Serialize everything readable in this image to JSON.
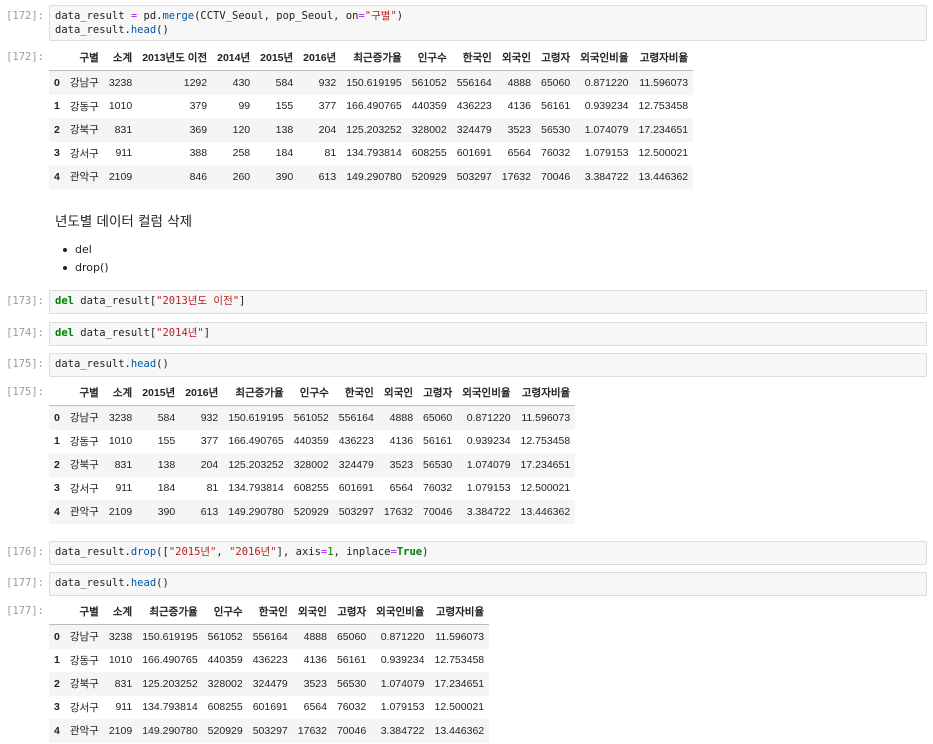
{
  "cells": [
    {
      "id": "c172in",
      "prompt": "[172]:",
      "code": [
        [
          [
            "plain",
            "data_result "
          ],
          [
            "op",
            "="
          ],
          [
            "plain",
            " pd."
          ],
          [
            "fn",
            "merge"
          ],
          [
            "plain",
            "(CCTV_Seoul, pop_Seoul, on"
          ],
          [
            "op",
            "="
          ],
          [
            "str",
            "\"구별\""
          ],
          [
            "plain",
            ")"
          ]
        ],
        [
          [
            "plain",
            "data_result."
          ],
          [
            "fn",
            "head"
          ],
          [
            "plain",
            "()"
          ]
        ]
      ]
    },
    {
      "id": "c173in",
      "prompt": "[173]:",
      "code": [
        [
          [
            "kw",
            "del"
          ],
          [
            "plain",
            " data_result["
          ],
          [
            "str",
            "\"2013년도 이전\""
          ],
          [
            "plain",
            "]"
          ]
        ]
      ]
    },
    {
      "id": "c174in",
      "prompt": "[174]:",
      "code": [
        [
          [
            "kw",
            "del"
          ],
          [
            "plain",
            " data_result["
          ],
          [
            "str",
            "\"2014년\""
          ],
          [
            "plain",
            "]"
          ]
        ]
      ]
    },
    {
      "id": "c175in",
      "prompt": "[175]:",
      "code": [
        [
          [
            "plain",
            "data_result."
          ],
          [
            "fn",
            "head"
          ],
          [
            "plain",
            "()"
          ]
        ]
      ]
    },
    {
      "id": "c176in",
      "prompt": "[176]:",
      "code": [
        [
          [
            "plain",
            "data_result."
          ],
          [
            "fn",
            "drop"
          ],
          [
            "plain",
            "(["
          ],
          [
            "str",
            "\"2015년\""
          ],
          [
            "plain",
            ", "
          ],
          [
            "str",
            "\"2016년\""
          ],
          [
            "plain",
            "], axis"
          ],
          [
            "op",
            "="
          ],
          [
            "num",
            "1"
          ],
          [
            "plain",
            ", inplace"
          ],
          [
            "op",
            "="
          ],
          [
            "kw",
            "True"
          ],
          [
            "plain",
            ")"
          ]
        ]
      ]
    },
    {
      "id": "c177in",
      "prompt": "[177]:",
      "code": [
        [
          [
            "plain",
            "data_result."
          ],
          [
            "fn",
            "head"
          ],
          [
            "plain",
            "()"
          ]
        ]
      ]
    }
  ],
  "outputs": [
    {
      "id": "o172",
      "prompt": "[172]:",
      "columns": [
        "",
        "구별",
        "소계",
        "2013년도 이전",
        "2014년",
        "2015년",
        "2016년",
        "최근증가율",
        "인구수",
        "한국인",
        "외국인",
        "고령자",
        "외국인비율",
        "고령자비율"
      ],
      "rows": [
        [
          "0",
          "강남구",
          "3238",
          "1292",
          "430",
          "584",
          "932",
          "150.619195",
          "561052",
          "556164",
          "4888",
          "65060",
          "0.871220",
          "11.596073"
        ],
        [
          "1",
          "강동구",
          "1010",
          "379",
          "99",
          "155",
          "377",
          "166.490765",
          "440359",
          "436223",
          "4136",
          "56161",
          "0.939234",
          "12.753458"
        ],
        [
          "2",
          "강북구",
          "831",
          "369",
          "120",
          "138",
          "204",
          "125.203252",
          "328002",
          "324479",
          "3523",
          "56530",
          "1.074079",
          "17.234651"
        ],
        [
          "3",
          "강서구",
          "911",
          "388",
          "258",
          "184",
          "81",
          "134.793814",
          "608255",
          "601691",
          "6564",
          "76032",
          "1.079153",
          "12.500021"
        ],
        [
          "4",
          "관악구",
          "2109",
          "846",
          "260",
          "390",
          "613",
          "149.290780",
          "520929",
          "503297",
          "17632",
          "70046",
          "3.384722",
          "13.446362"
        ]
      ]
    },
    {
      "id": "o175",
      "prompt": "[175]:",
      "columns": [
        "",
        "구별",
        "소계",
        "2015년",
        "2016년",
        "최근증가율",
        "인구수",
        "한국인",
        "외국인",
        "고령자",
        "외국인비율",
        "고령자비율"
      ],
      "rows": [
        [
          "0",
          "강남구",
          "3238",
          "584",
          "932",
          "150.619195",
          "561052",
          "556164",
          "4888",
          "65060",
          "0.871220",
          "11.596073"
        ],
        [
          "1",
          "강동구",
          "1010",
          "155",
          "377",
          "166.490765",
          "440359",
          "436223",
          "4136",
          "56161",
          "0.939234",
          "12.753458"
        ],
        [
          "2",
          "강북구",
          "831",
          "138",
          "204",
          "125.203252",
          "328002",
          "324479",
          "3523",
          "56530",
          "1.074079",
          "17.234651"
        ],
        [
          "3",
          "강서구",
          "911",
          "184",
          "81",
          "134.793814",
          "608255",
          "601691",
          "6564",
          "76032",
          "1.079153",
          "12.500021"
        ],
        [
          "4",
          "관악구",
          "2109",
          "390",
          "613",
          "149.290780",
          "520929",
          "503297",
          "17632",
          "70046",
          "3.384722",
          "13.446362"
        ]
      ]
    },
    {
      "id": "o177",
      "prompt": "[177]:",
      "columns": [
        "",
        "구별",
        "소계",
        "최근증가율",
        "인구수",
        "한국인",
        "외국인",
        "고령자",
        "외국인비율",
        "고령자비율"
      ],
      "rows": [
        [
          "0",
          "강남구",
          "3238",
          "150.619195",
          "561052",
          "556164",
          "4888",
          "65060",
          "0.871220",
          "11.596073"
        ],
        [
          "1",
          "강동구",
          "1010",
          "166.490765",
          "440359",
          "436223",
          "4136",
          "56161",
          "0.939234",
          "12.753458"
        ],
        [
          "2",
          "강북구",
          "831",
          "125.203252",
          "328002",
          "324479",
          "3523",
          "56530",
          "1.074079",
          "17.234651"
        ],
        [
          "3",
          "강서구",
          "911",
          "134.793814",
          "608255",
          "601691",
          "6564",
          "76032",
          "1.079153",
          "12.500021"
        ],
        [
          "4",
          "관악구",
          "2109",
          "149.290780",
          "520929",
          "503297",
          "17632",
          "70046",
          "3.384722",
          "13.446362"
        ]
      ]
    }
  ],
  "markdown": {
    "title": "년도별 데이터 컬럼 삭제",
    "items": [
      "del",
      "drop()"
    ]
  }
}
